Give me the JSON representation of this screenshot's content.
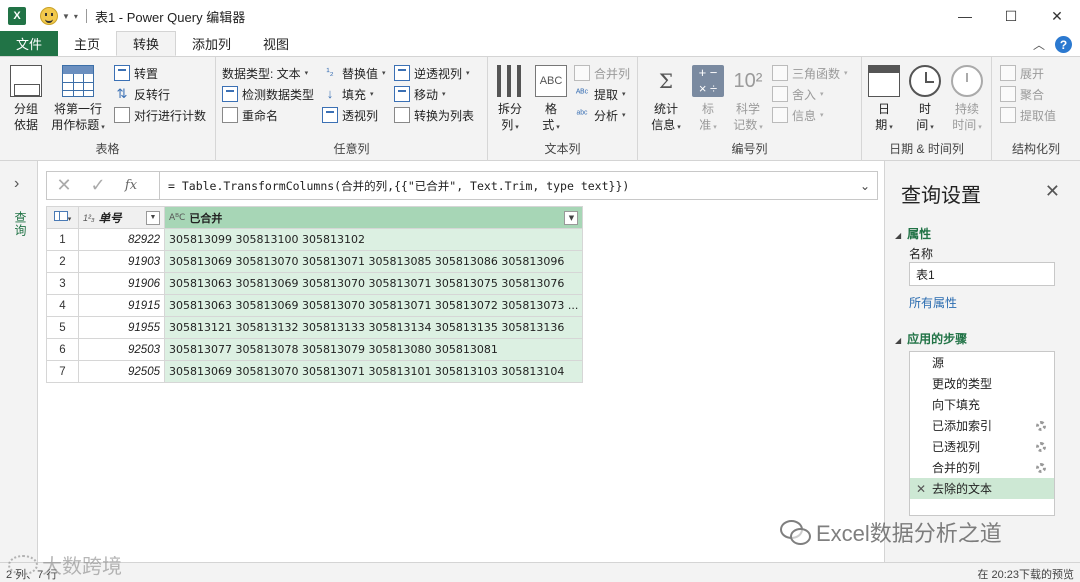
{
  "window": {
    "title": "表1 - Power Query 编辑器"
  },
  "menu": {
    "tabs": [
      "文件",
      "主页",
      "转换",
      "添加列",
      "视图"
    ],
    "active": "转换"
  },
  "ribbon": {
    "table_group": {
      "label": "表格",
      "group_by": [
        "分组",
        "依据"
      ],
      "first_row_header": [
        "将第一行",
        "用作标题"
      ],
      "transpose": "转置",
      "reverse_rows": "反转行",
      "count_rows": "对行进行计数"
    },
    "any_column_group": {
      "label": "任意列",
      "data_type": "数据类型: 文本",
      "detect_type": "检测数据类型",
      "rename": "重命名",
      "replace_values": "替换值",
      "fill": "填充",
      "pivot": "透视列",
      "unpivot": "逆透视列",
      "move": "移动",
      "to_list": "转换为列表"
    },
    "text_column_group": {
      "label": "文本列",
      "split": [
        "拆分",
        "列"
      ],
      "format": [
        "格",
        "式"
      ],
      "merge_columns": "合并列",
      "extract": "提取",
      "parse": "分析"
    },
    "number_column_group": {
      "label": "编号列",
      "statistics": [
        "统计",
        "信息"
      ],
      "standard": [
        "标",
        "准"
      ],
      "scientific": [
        "科学",
        "记数"
      ],
      "trigonometry": "三角函数",
      "rounding": "舍入",
      "information": "信息"
    },
    "datetime_group": {
      "label": "日期 & 时间列",
      "date": [
        "日",
        "期"
      ],
      "time": [
        "时",
        "间"
      ],
      "duration": [
        "持续",
        "时间"
      ]
    },
    "structured_group": {
      "label": "结构化列",
      "expand": "展开",
      "aggregate": "聚合",
      "extract_values": "提取值"
    }
  },
  "nav": {
    "label": "查询"
  },
  "formula": {
    "text": "= Table.TransformColumns(合并的列,{{\"已合并\", Text.Trim, type text}})"
  },
  "table": {
    "columns": [
      {
        "type": "1²₃",
        "name": "单号"
      },
      {
        "type": "AᴮC",
        "name": "已合并"
      }
    ],
    "rows": [
      {
        "i": "1",
        "id": "82922",
        "merged": "305813099 305813100 305813102"
      },
      {
        "i": "2",
        "id": "91903",
        "merged": "305813069 305813070 305813071 305813085 305813086 305813096"
      },
      {
        "i": "3",
        "id": "91906",
        "merged": "305813063 305813069 305813070 305813071 305813075 305813076"
      },
      {
        "i": "4",
        "id": "91915",
        "merged": "305813063 305813069 305813070 305813071 305813072 305813073 ..."
      },
      {
        "i": "5",
        "id": "91955",
        "merged": "305813121 305813132 305813133 305813134 305813135 305813136"
      },
      {
        "i": "6",
        "id": "92503",
        "merged": "305813077 305813078 305813079 305813080 305813081"
      },
      {
        "i": "7",
        "id": "92505",
        "merged": "305813069 305813070 305813071 305813101 305813103 305813104"
      }
    ]
  },
  "settings": {
    "title": "查询设置",
    "properties_label": "属性",
    "name_label": "名称",
    "name_value": "表1",
    "all_properties": "所有属性",
    "applied_steps_label": "应用的步骤",
    "steps": [
      {
        "name": "源",
        "gear": false
      },
      {
        "name": "更改的类型",
        "gear": false
      },
      {
        "name": "向下填充",
        "gear": false
      },
      {
        "name": "已添加索引",
        "gear": true
      },
      {
        "name": "已透视列",
        "gear": true
      },
      {
        "name": "合并的列",
        "gear": true
      },
      {
        "name": "去除的文本",
        "gear": false,
        "selected": true
      }
    ]
  },
  "status": {
    "left": "2 列、7 行",
    "right": "在 20:23下载的预览"
  },
  "watermarks": {
    "wechat": "Excel数据分析之道",
    "brand": "大数跨境"
  },
  "colors": {
    "excel_green": "#217346",
    "selected_column": "#dcf0e2",
    "selected_step": "#cde8d4",
    "help_blue": "#2b79d0"
  }
}
